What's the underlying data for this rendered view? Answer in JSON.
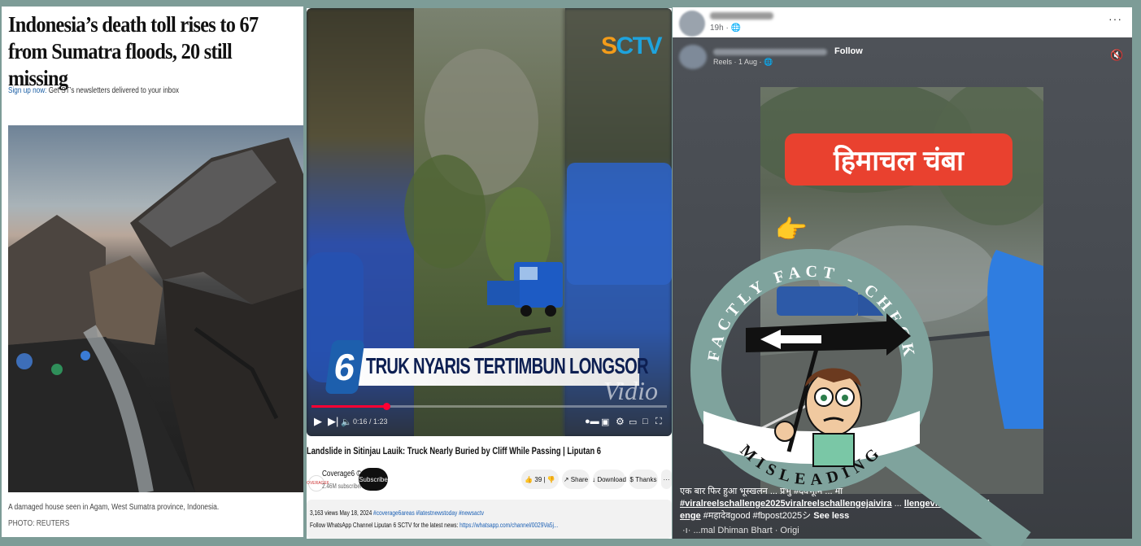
{
  "article": {
    "headline": "Indonesia’s death toll rises to 67 from Sumatra floods, 20 still missing",
    "signup_link": "Sign up now:",
    "signup_text": " Get ST’s newsletters delivered to your inbox",
    "caption": "A damaged house seen in Agam, West Sumatra province, Indonesia.",
    "credit": "PHOTO: REUTERS"
  },
  "video": {
    "channel_logo_text": "SCTV",
    "channel_logo_accent": "S",
    "lower_third_number": "6",
    "lower_third_text": "TRUK NYARIS TERTIMBUN LONGSOR",
    "watermark": "Vidio",
    "time": "0:16 / 1:23",
    "progress": 0.21,
    "title": "Landslide in Sitinjau Lauik: Truck Nearly Buried by Cliff While Passing | Liputan 6",
    "channel_name": "Coverage6 ©",
    "channel_logo_mini": "COVERAGE6",
    "subscribers": "2.46M subscribers",
    "subscribe_label": "Subscribe",
    "likes": "39",
    "share_label": "Share",
    "download_label": "Download",
    "thanks_label": "Thanks",
    "more_label": "···",
    "views_date": "3,163 views  May 18, 2024 ",
    "hashtags": "#coverage6areas #latestnewstoday #newsactv",
    "follow_text": "Follow WhatsApp Channel Liputan 6 SCTV for the latest news: ",
    "follow_link": "https://whatsapp.com/channel/0029Va5j..."
  },
  "facebook": {
    "post_time": "19h · 🌐",
    "more_icon": "···",
    "follow_label": "Follow",
    "reel_meta": "Reels · 1 Aug · 🌐",
    "overlay_text": "हिमाचल चंबा",
    "caption_start": "एक बार फिर हुआ भूस्खलन",
    "caption_mid": " ... प्रभु  #देवभूमि ... ",
    "caption_end": "मा",
    "tags_line1": "#viralreelschallenge2025viralreelschallengejaivira",
    "tags_line1b": "llengeviralreelschall",
    "tags_line2": "enge",
    "tags_rest": " #महादेवgood #fbpost2025シ ",
    "see_less": "See less",
    "audio_text": "·ı· ...mal Dhiman Bhart · Origi"
  },
  "stamp": {
    "top_text": "FACTLY FACT - CHECK",
    "bottom_text": "MISLEADING",
    "ring_color": "#7fa39d",
    "dark_color": "#111111"
  }
}
